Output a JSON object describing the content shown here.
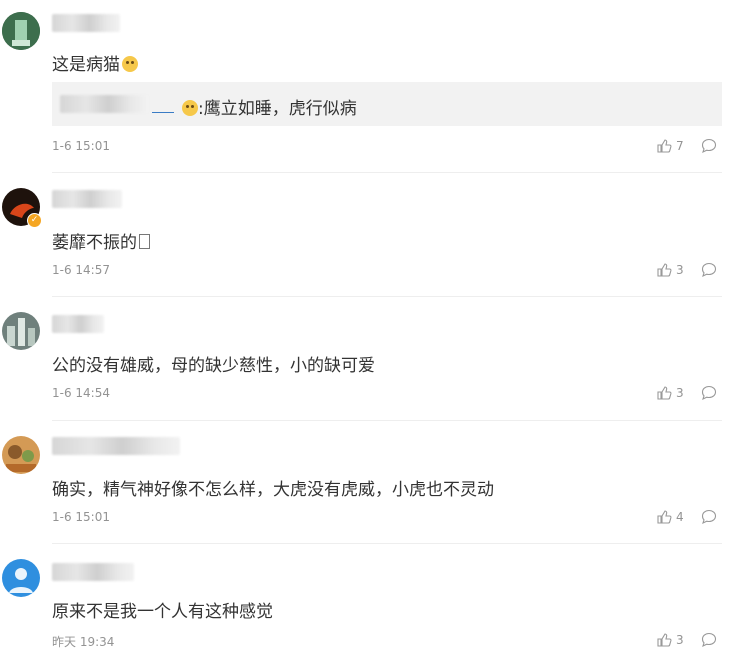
{
  "comments": [
    {
      "text": "这是病猫",
      "quote": {
        "text": ":鹰立如睡，虎行似病"
      },
      "time": "1-6 15:01",
      "likes": "7",
      "avatar": {
        "bg": "#2f5d3f",
        "accent": "#8fc4a0"
      }
    },
    {
      "text": "萎靡不振的",
      "time": "1-6 14:57",
      "likes": "3",
      "avatar": {
        "bg": "#2a1a12",
        "accent": "#e0471b"
      },
      "verified": true
    },
    {
      "text": "公的没有雄威，母的缺少慈性，小的缺可爱",
      "time": "1-6 14:54",
      "likes": "3",
      "avatar": {
        "bg": "#5b6b6a",
        "accent": "#a8b8b0"
      }
    },
    {
      "text": "确实，精气神好像不怎么样，大虎没有虎威，小虎也不灵动",
      "time": "1-6 15:01",
      "likes": "4",
      "avatar": {
        "bg": "#c8873c",
        "accent": "#7e9a4a"
      }
    },
    {
      "text": "原来不是我一个人有这种感觉",
      "time": "昨天 19:34",
      "likes": "3",
      "avatar": {
        "bg": "#2f8fdf",
        "accent": "#ffffff"
      }
    }
  ]
}
